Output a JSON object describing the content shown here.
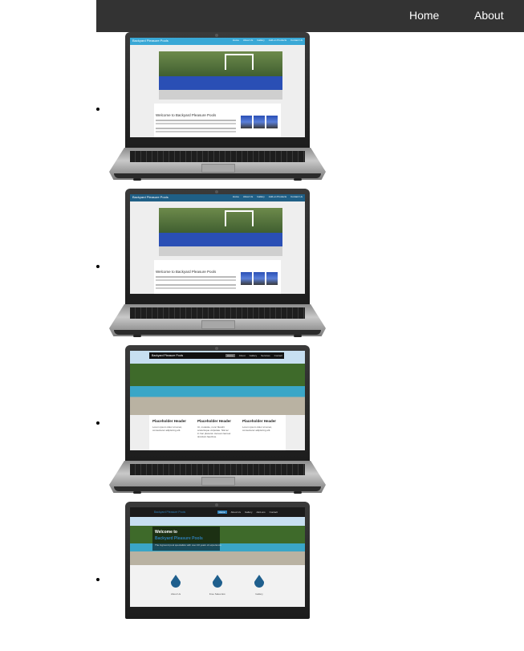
{
  "nav": {
    "home_label": "Home",
    "about_label": "About"
  },
  "slides": [
    {
      "site_title": "Backyard Pleasure Pools",
      "menu": [
        "Home",
        "About Us",
        "Gallery",
        "Add-on Products",
        "Contact Us"
      ],
      "welcome": "Welcome to Backyard Pleasure Pools"
    },
    {
      "site_title": "Backyard Pleasure Pools",
      "menu": [
        "Home",
        "About Us",
        "Gallery",
        "Add-on Products",
        "Contact Us"
      ],
      "welcome": "Welcome to Backyard Pleasure Pools"
    },
    {
      "site_title": "Backyard Pleasure Pools",
      "menu": [
        "Home",
        "About",
        "Gallery",
        "Services",
        "Contact"
      ],
      "headers": [
        "Placeholder Header",
        "Placeholder Header",
        "Placeholder Header"
      ],
      "texts": [
        "Lorem ipsum dolor sit amet, consectetur adipiscing elit.",
        "Ut, molestie, nunc blandit scelerisque vulputate. Nisl ac in hac placerat. Aenean laoreet tincidunt faucibus.",
        "Lorem ipsum dolor sit amet, consectetur adipiscing elit."
      ]
    },
    {
      "site_title": "Backyard Pleasure Pools",
      "menu": [
        "Home",
        "About Us",
        "Gallery",
        "Add-ons",
        "Contact"
      ],
      "welcome": "Welcome to",
      "brand": "Backyard Pleasure Pools",
      "tagline": "The inground pool specialists with over 20 years of experience",
      "features": [
        "About Us",
        "Free Sales Est.",
        "Gallery"
      ]
    }
  ],
  "colors": {
    "navbar": "#333333",
    "site_blue": "#39a8d6",
    "accent_blue": "#2e7fb8"
  }
}
